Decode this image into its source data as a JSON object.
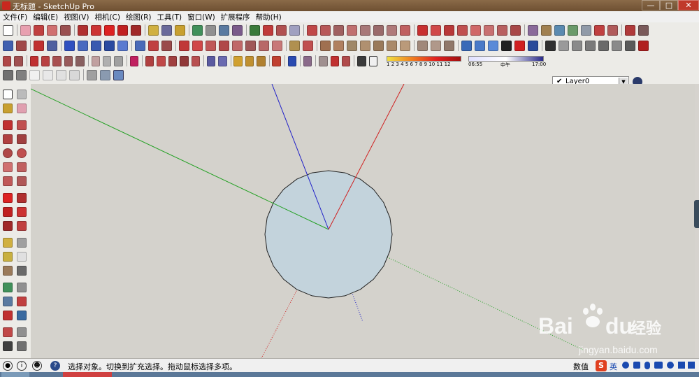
{
  "window": {
    "title": "无标题 - SketchUp Pro"
  },
  "menu": [
    "文件(F)",
    "编辑(E)",
    "视图(V)",
    "相机(C)",
    "绘图(R)",
    "工具(T)",
    "窗口(W)",
    "扩展程序",
    "帮助(H)"
  ],
  "shadow": {
    "months": [
      "1",
      "2",
      "3",
      "4",
      "5",
      "6",
      "7",
      "8",
      "9",
      "10",
      "11",
      "12"
    ],
    "time_start": "06:55",
    "time_mid": "中午",
    "time_end": "17:00"
  },
  "layer": {
    "current": "Layer0"
  },
  "status": {
    "message": "选择对象。切换到扩充选择。拖动鼠标选择多项。",
    "measure_label": "数值"
  },
  "ime": {
    "lang": "英"
  },
  "watermark": {
    "brand": "Bai",
    "brand2": "du",
    "cn": "经验",
    "url": "jingyan.baidu.com"
  },
  "colors": {
    "red_axis": "#d02020",
    "green_axis": "#22a022",
    "blue_axis": "#2020c8",
    "circle_fill": "#c3d3dc"
  }
}
